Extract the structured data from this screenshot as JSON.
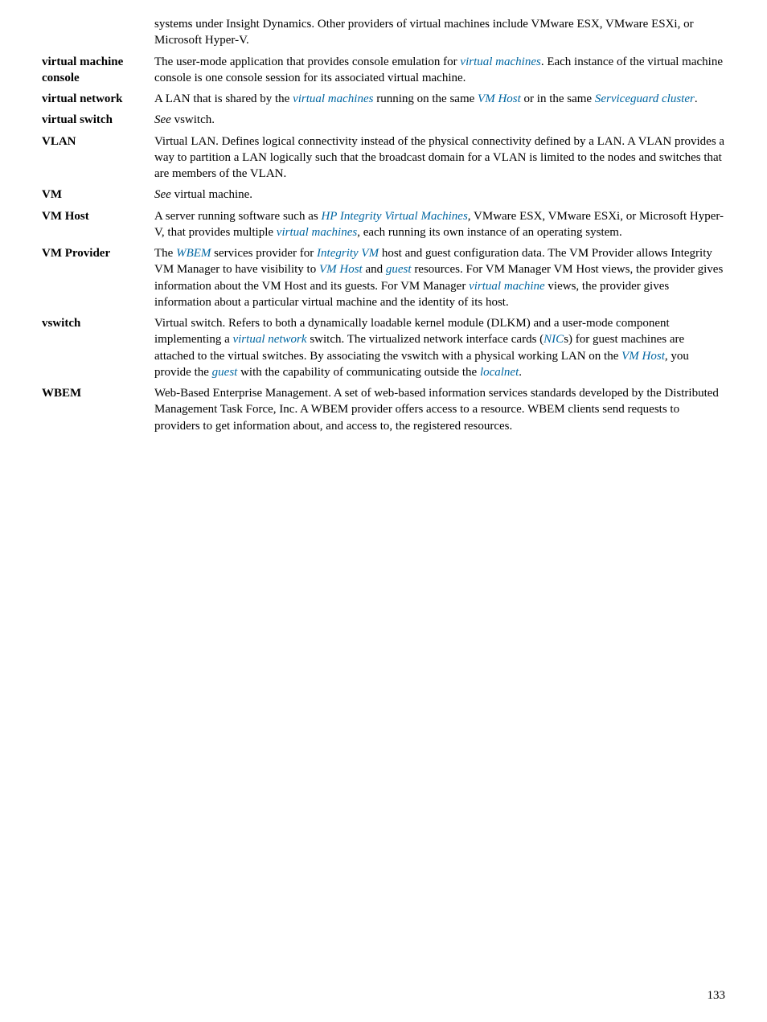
{
  "pageNumber": "133",
  "entries": [
    {
      "term": "",
      "segments": [
        {
          "t": "systems under Insight Dynamics. Other providers of virtual machines include VMware ESX, VMware ESXi, or Microsoft Hyper-V."
        }
      ]
    },
    {
      "term": "virtual machine console",
      "segments": [
        {
          "t": "The user-mode application that provides console emulation for "
        },
        {
          "t": "virtual machines",
          "link": true,
          "italic": true
        },
        {
          "t": ". Each instance of the virtual machine console is one console session for its associated virtual machine."
        }
      ]
    },
    {
      "term": "virtual network",
      "segments": [
        {
          "t": "A LAN that is shared by the "
        },
        {
          "t": "virtual machines",
          "link": true,
          "italic": true
        },
        {
          "t": " running on the same "
        },
        {
          "t": "VM Host",
          "link": true,
          "italic": true
        },
        {
          "t": " or in the same "
        },
        {
          "t": "Serviceguard cluster",
          "link": true,
          "italic": true
        },
        {
          "t": "."
        }
      ]
    },
    {
      "term": "virtual switch",
      "segments": [
        {
          "t": "See",
          "italic": true
        },
        {
          "t": " vswitch."
        }
      ]
    },
    {
      "term": "VLAN",
      "segments": [
        {
          "t": "Virtual LAN. Defines logical connectivity instead of the physical connectivity defined by a LAN. A VLAN provides a way to partition a LAN logically such that the broadcast domain for a VLAN is limited to the nodes and switches that are members of the VLAN."
        }
      ]
    },
    {
      "term": "VM",
      "segments": [
        {
          "t": "See",
          "italic": true
        },
        {
          "t": " virtual machine."
        }
      ]
    },
    {
      "term": "VM Host",
      "segments": [
        {
          "t": "A server running software such as "
        },
        {
          "t": "HP Integrity Virtual Machines",
          "link": true,
          "italic": true
        },
        {
          "t": ", VMware ESX, VMware ESXi, or Microsoft Hyper-V, that provides multiple "
        },
        {
          "t": "virtual machines",
          "link": true,
          "italic": true
        },
        {
          "t": ", each running its own instance of an operating system."
        }
      ]
    },
    {
      "term": "VM Provider",
      "segments": [
        {
          "t": "The "
        },
        {
          "t": "WBEM",
          "link": true,
          "italic": true
        },
        {
          "t": " services provider for "
        },
        {
          "t": "Integrity VM",
          "link": true,
          "italic": true
        },
        {
          "t": " host and guest configuration data. The VM Provider allows Integrity VM Manager to have visibility to "
        },
        {
          "t": "VM Host",
          "link": true,
          "italic": true
        },
        {
          "t": " and "
        },
        {
          "t": "guest",
          "link": true,
          "italic": true
        },
        {
          "t": " resources. For VM Manager VM Host views, the provider gives information about the VM Host and its guests. For VM Manager "
        },
        {
          "t": "virtual machine",
          "link": true,
          "italic": true
        },
        {
          "t": " views, the provider gives information about a particular virtual machine and the identity of its host."
        }
      ]
    },
    {
      "term": "vswitch",
      "segments": [
        {
          "t": "Virtual switch. Refers to both a dynamically loadable kernel module (DLKM) and a user-mode component implementing a "
        },
        {
          "t": "virtual network",
          "link": true,
          "italic": true
        },
        {
          "t": " switch. The virtualized network interface cards ("
        },
        {
          "t": "NIC",
          "link": true,
          "italic": true
        },
        {
          "t": "s) for guest machines are attached to the virtual switches. By associating the vswitch with a physical working LAN on the "
        },
        {
          "t": "VM Host",
          "link": true,
          "italic": true
        },
        {
          "t": ", you provide the "
        },
        {
          "t": "guest",
          "link": true,
          "italic": true
        },
        {
          "t": " with the capability of communicating outside the "
        },
        {
          "t": "localnet",
          "link": true,
          "italic": true
        },
        {
          "t": "."
        }
      ]
    },
    {
      "term": "WBEM",
      "segments": [
        {
          "t": "Web-Based Enterprise Management. A set of web-based information services standards developed by the Distributed Management Task Force, Inc. A WBEM provider offers access to a resource. WBEM clients send requests to providers to get information about, and access to, the registered resources."
        }
      ]
    }
  ]
}
